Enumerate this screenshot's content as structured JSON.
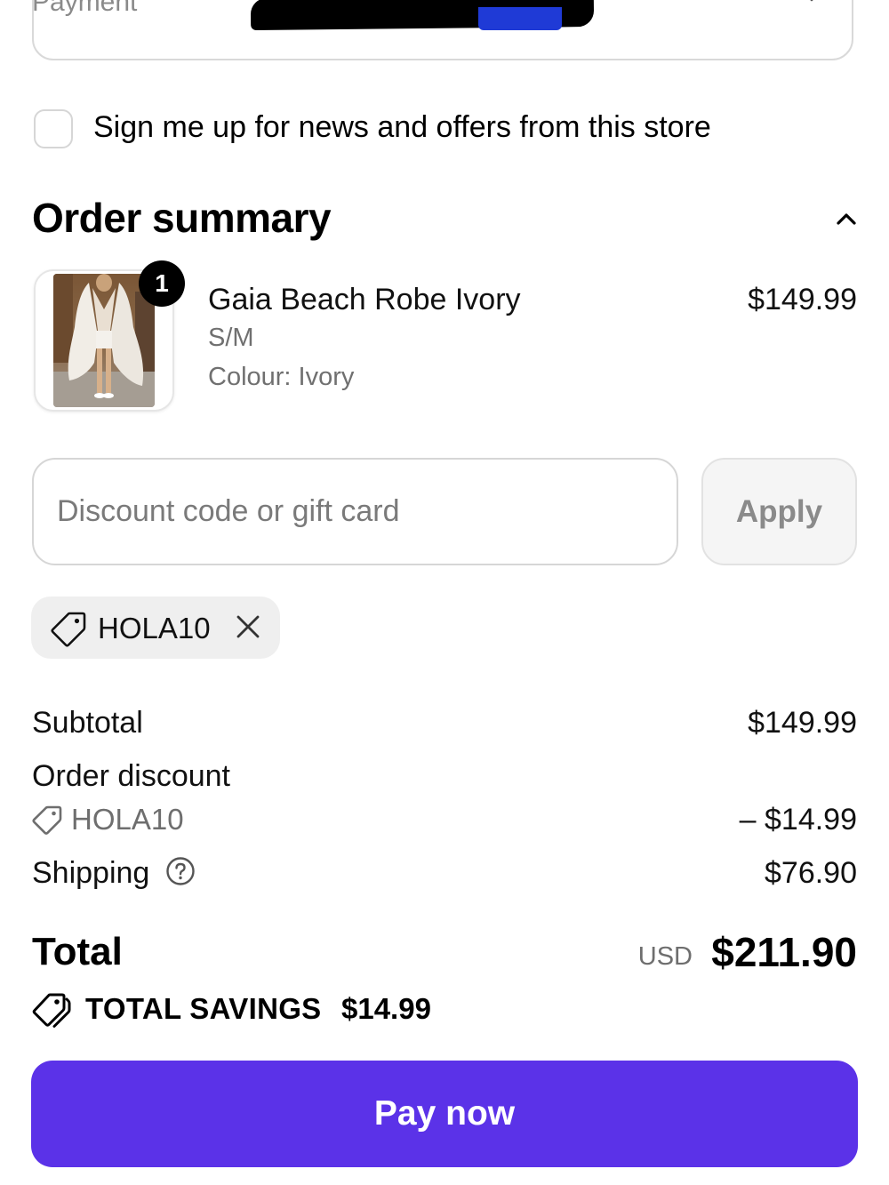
{
  "payment": {
    "label": "Payment",
    "icon": "chevron-down-icon"
  },
  "newsletter": {
    "label": "Sign me up for news and offers from this store",
    "checked": false
  },
  "order_summary": {
    "title": "Order summary",
    "toggle_icon": "chevron-up-icon",
    "items": [
      {
        "quantity": "1",
        "name": "Gaia Beach Robe Ivory",
        "variant": "S/M",
        "colour": "Colour: Ivory",
        "price": "$149.99"
      }
    ]
  },
  "discount": {
    "placeholder": "Discount code or gift card",
    "value": "",
    "apply_label": "Apply",
    "applied_code": "HOLA10"
  },
  "totals": {
    "subtotal_label": "Subtotal",
    "subtotal_value": "$149.99",
    "order_discount_label": "Order discount",
    "order_discount_code": "HOLA10",
    "order_discount_value": "– $14.99",
    "shipping_label": "Shipping",
    "shipping_value": "$76.90",
    "total_label": "Total",
    "currency": "USD",
    "total_value": "$211.90",
    "savings_label": "TOTAL SAVINGS",
    "savings_value": "$14.99"
  },
  "pay_button": {
    "label": "Pay now",
    "color": "#5b32e8"
  }
}
